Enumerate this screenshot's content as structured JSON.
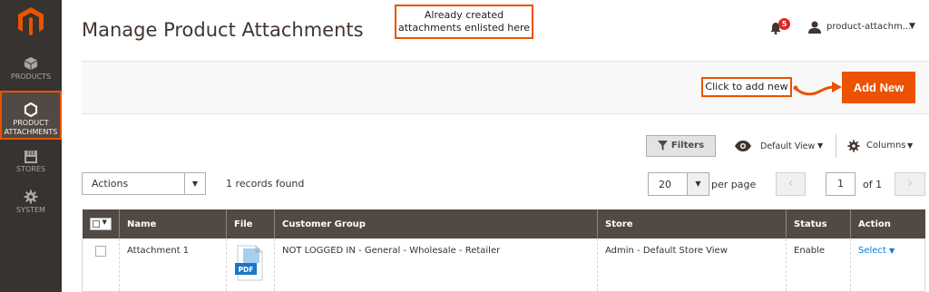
{
  "sidebar": {
    "items": [
      {
        "label": "PRODUCTS",
        "icon": "cube-icon"
      },
      {
        "label": "PRODUCT ATTACHMENTS",
        "line1": "PRODUCT",
        "line2": "ATTACHMENTS",
        "icon": "hexagon-icon",
        "active": true
      },
      {
        "label": "STORES",
        "icon": "store-icon"
      },
      {
        "label": "SYSTEM",
        "icon": "gear-icon"
      }
    ]
  },
  "header": {
    "title": "Manage Product Attachments",
    "notification_count": "5",
    "user_name": "product-attachm..."
  },
  "callouts": {
    "top_line1": "Already created",
    "top_line2": "attachments enlisted here",
    "add": "Click to add new"
  },
  "toolbar": {
    "add_new_label": "Add New",
    "filters_label": "Filters",
    "view_label": "Default View",
    "columns_label": "Columns"
  },
  "grid_controls": {
    "actions_label": "Actions",
    "records_found": "1 records found",
    "per_page_value": "20",
    "per_page_label": "per page",
    "current_page": "1",
    "of_pages": "of 1"
  },
  "table": {
    "columns": [
      "Name",
      "File",
      "Customer Group",
      "Store",
      "Status",
      "Action"
    ],
    "rows": [
      {
        "name": "Attachment 1",
        "file_label": "PDF",
        "customer_group": "NOT LOGGED IN - General - Wholesale - Retailer",
        "store": "Admin - Default Store View",
        "status": "Enable",
        "action": "Select"
      }
    ]
  },
  "colors": {
    "accent": "#eb5202",
    "sidebar": "#373330",
    "table_header": "#514943",
    "link": "#007bdb"
  }
}
